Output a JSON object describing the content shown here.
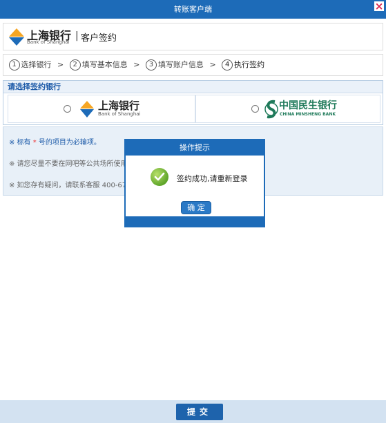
{
  "window": {
    "title": "转账客户端",
    "close_label": "×"
  },
  "header": {
    "bank_name_cn": "上海银行",
    "bank_name_en": "Bank of Shanghai",
    "separator": "|",
    "title": "客户签约"
  },
  "steps": [
    {
      "num": "1",
      "label": "选择银行"
    },
    {
      "num": "2",
      "label": "填写基本信息"
    },
    {
      "num": "3",
      "label": "填写账户信息"
    },
    {
      "num": "4",
      "label": "执行签约"
    }
  ],
  "step_arrow": ">",
  "bank_select": {
    "heading": "请选择签约银行",
    "options": [
      {
        "name_cn": "上海银行",
        "name_en": "Bank of Shanghai"
      },
      {
        "name_cn": "中国民生银行",
        "name_en": "CHINA MINSHENG BANK"
      }
    ]
  },
  "notice": {
    "line1_prefix": "※ 标有",
    "line1_star": " * ",
    "line1_suffix": "号的项目为必输项。",
    "line2": "※ 请您尽量不要在网吧等公共场所使用此",
    "line3": "※ 如您存有疑问，请联系客服 400-673-3"
  },
  "dialog": {
    "title": "操作提示",
    "message": "签约成功,请重新登录",
    "ok_label": "确 定"
  },
  "footer": {
    "submit_label": "提交"
  },
  "colors": {
    "primary": "#1d6bb8",
    "close": "#d9234d",
    "accent_red": "#ee3333"
  }
}
